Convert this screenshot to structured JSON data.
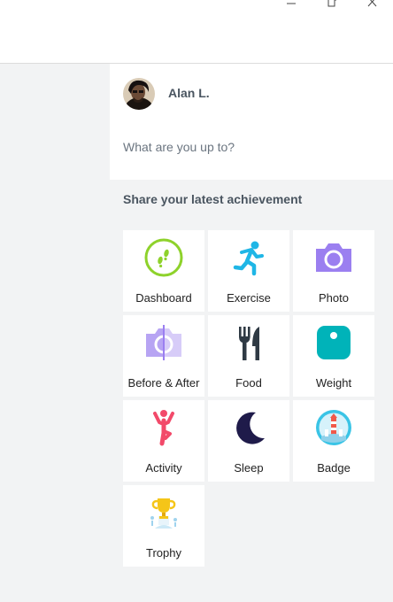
{
  "window": {
    "minimize_icon": "minimize-icon",
    "maximize_icon": "maximize-icon",
    "close_icon": "close-icon"
  },
  "composer": {
    "user_name": "Alan L.",
    "placeholder": "What are you up to?",
    "value": ""
  },
  "achievements": {
    "title": "Share your latest achievement",
    "tiles": [
      {
        "label": "Dashboard",
        "icon": "dashboard-icon",
        "color": "#8ed22b"
      },
      {
        "label": "Exercise",
        "icon": "exercise-icon",
        "color": "#1fb6e6"
      },
      {
        "label": "Photo",
        "icon": "camera-icon",
        "color": "#9b7ff0"
      },
      {
        "label": "Before & After",
        "icon": "before-after-icon",
        "color": "#b7a4f3"
      },
      {
        "label": "Food",
        "icon": "food-icon",
        "color": "#2f3a44"
      },
      {
        "label": "Weight",
        "icon": "scale-icon",
        "color": "#00b3b9"
      },
      {
        "label": "Activity",
        "icon": "activity-icon",
        "color": "#f24a6a"
      },
      {
        "label": "Sleep",
        "icon": "moon-icon",
        "color": "#1f1b4a"
      },
      {
        "label": "Badge",
        "icon": "badge-icon",
        "color": "#3ac4e6"
      },
      {
        "label": "Trophy",
        "icon": "trophy-icon",
        "color": "#f5c518"
      }
    ]
  },
  "colors": {
    "background": "#f2f3f4",
    "card": "#ffffff",
    "heading": "#4a5560"
  }
}
